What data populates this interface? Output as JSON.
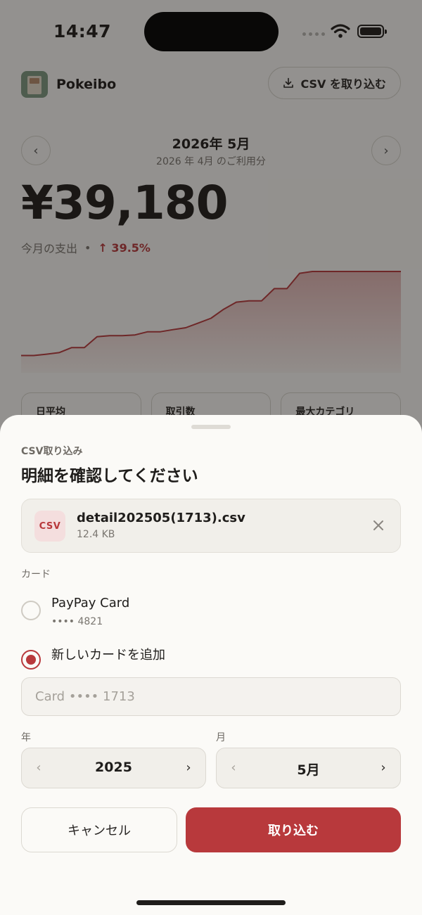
{
  "status_bar": {
    "time": "14:47"
  },
  "app": {
    "name": "Pokeibo",
    "csv_button_label": "CSV を取り込む",
    "month_title": "2026年 5月",
    "month_subtitle": "2026 年 4月 のご利用分",
    "prev_icon": "chevron-left-icon",
    "next_icon": "chevron-right-icon",
    "total_amount": "¥39,180",
    "spend_label": "今月の支出",
    "separator": "•",
    "change": "↑ 39.5%",
    "accent_color": "#b8393c",
    "stat_cards": [
      {
        "label": "日平均"
      },
      {
        "label": "取引数"
      },
      {
        "label": "最大カテゴリ"
      }
    ]
  },
  "chart_data": {
    "type": "area",
    "description_values_cumulative_yen": [
      1200,
      1200,
      1700,
      2300,
      4200,
      4200,
      8300,
      8700,
      8700,
      9000,
      10200,
      10200,
      11000,
      11700,
      13500,
      15300,
      18700,
      21400,
      21900,
      21900,
      26500,
      26500,
      32300,
      33000,
      33000,
      33000,
      33000,
      33000,
      33000,
      33000,
      33000
    ],
    "color": "#b8393c",
    "grid": false
  },
  "sheet": {
    "eyebrow": "CSV取り込み",
    "title": "明細を確認してください",
    "file": {
      "badge": "CSV",
      "name": "detail202505(1713).csv",
      "size": "12.4 KB"
    },
    "card_section_label": "カード",
    "card_options": [
      {
        "title": "PayPay Card",
        "sub": "•••• 4821",
        "selected": false
      },
      {
        "title": "新しいカードを追加",
        "selected": true
      }
    ],
    "card_name_placeholder": "Card •••• 1713",
    "year_label": "年",
    "year_value": "2025",
    "month_label": "月",
    "month_value": "5月",
    "cancel_label": "キャンセル",
    "import_label": "取り込む"
  }
}
